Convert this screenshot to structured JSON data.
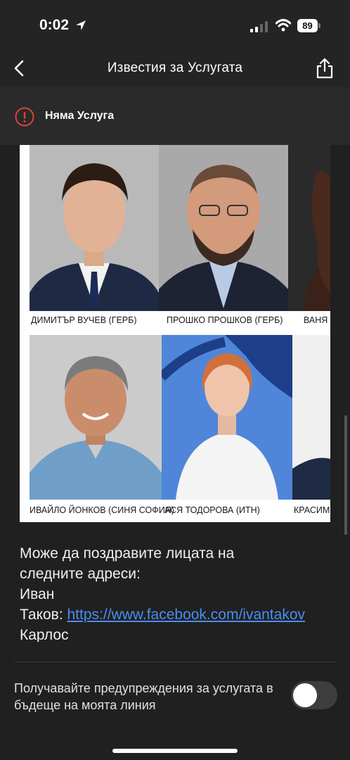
{
  "status_bar": {
    "time": "0:02",
    "battery": "89"
  },
  "nav": {
    "title": "Известия за Услугата"
  },
  "service": {
    "label": "Няма Услуга"
  },
  "image": {
    "captions": [
      "ДИМИТЪР ВУЧЕВ (ГЕРБ)",
      "ПРОШКО ПРОШКОВ (ГЕРБ)",
      "ВАНЯ",
      "ИВАЙЛО ЙОНКОВ (СИНЯ СОФИЯ)",
      "АСЯ ТОДОРОВА (ИТН)",
      "КРАСИМ"
    ]
  },
  "message": {
    "line1": "Може да поздравите лицата на",
    "line2": "следните адреси:",
    "line3": "Иван",
    "line4_prefix": "Таков: ",
    "line4_link": "https://www.facebook.com/ivantakov",
    "line5": "Карлос"
  },
  "settings": {
    "future_alerts_label": "Получавайте предупреждения за услугата в бъдеще на моята линия",
    "future_alerts_enabled": false
  },
  "colors": {
    "background": "#202020",
    "header": "#242424",
    "alert_red": "#e0403a",
    "link": "#4a8ef0"
  }
}
